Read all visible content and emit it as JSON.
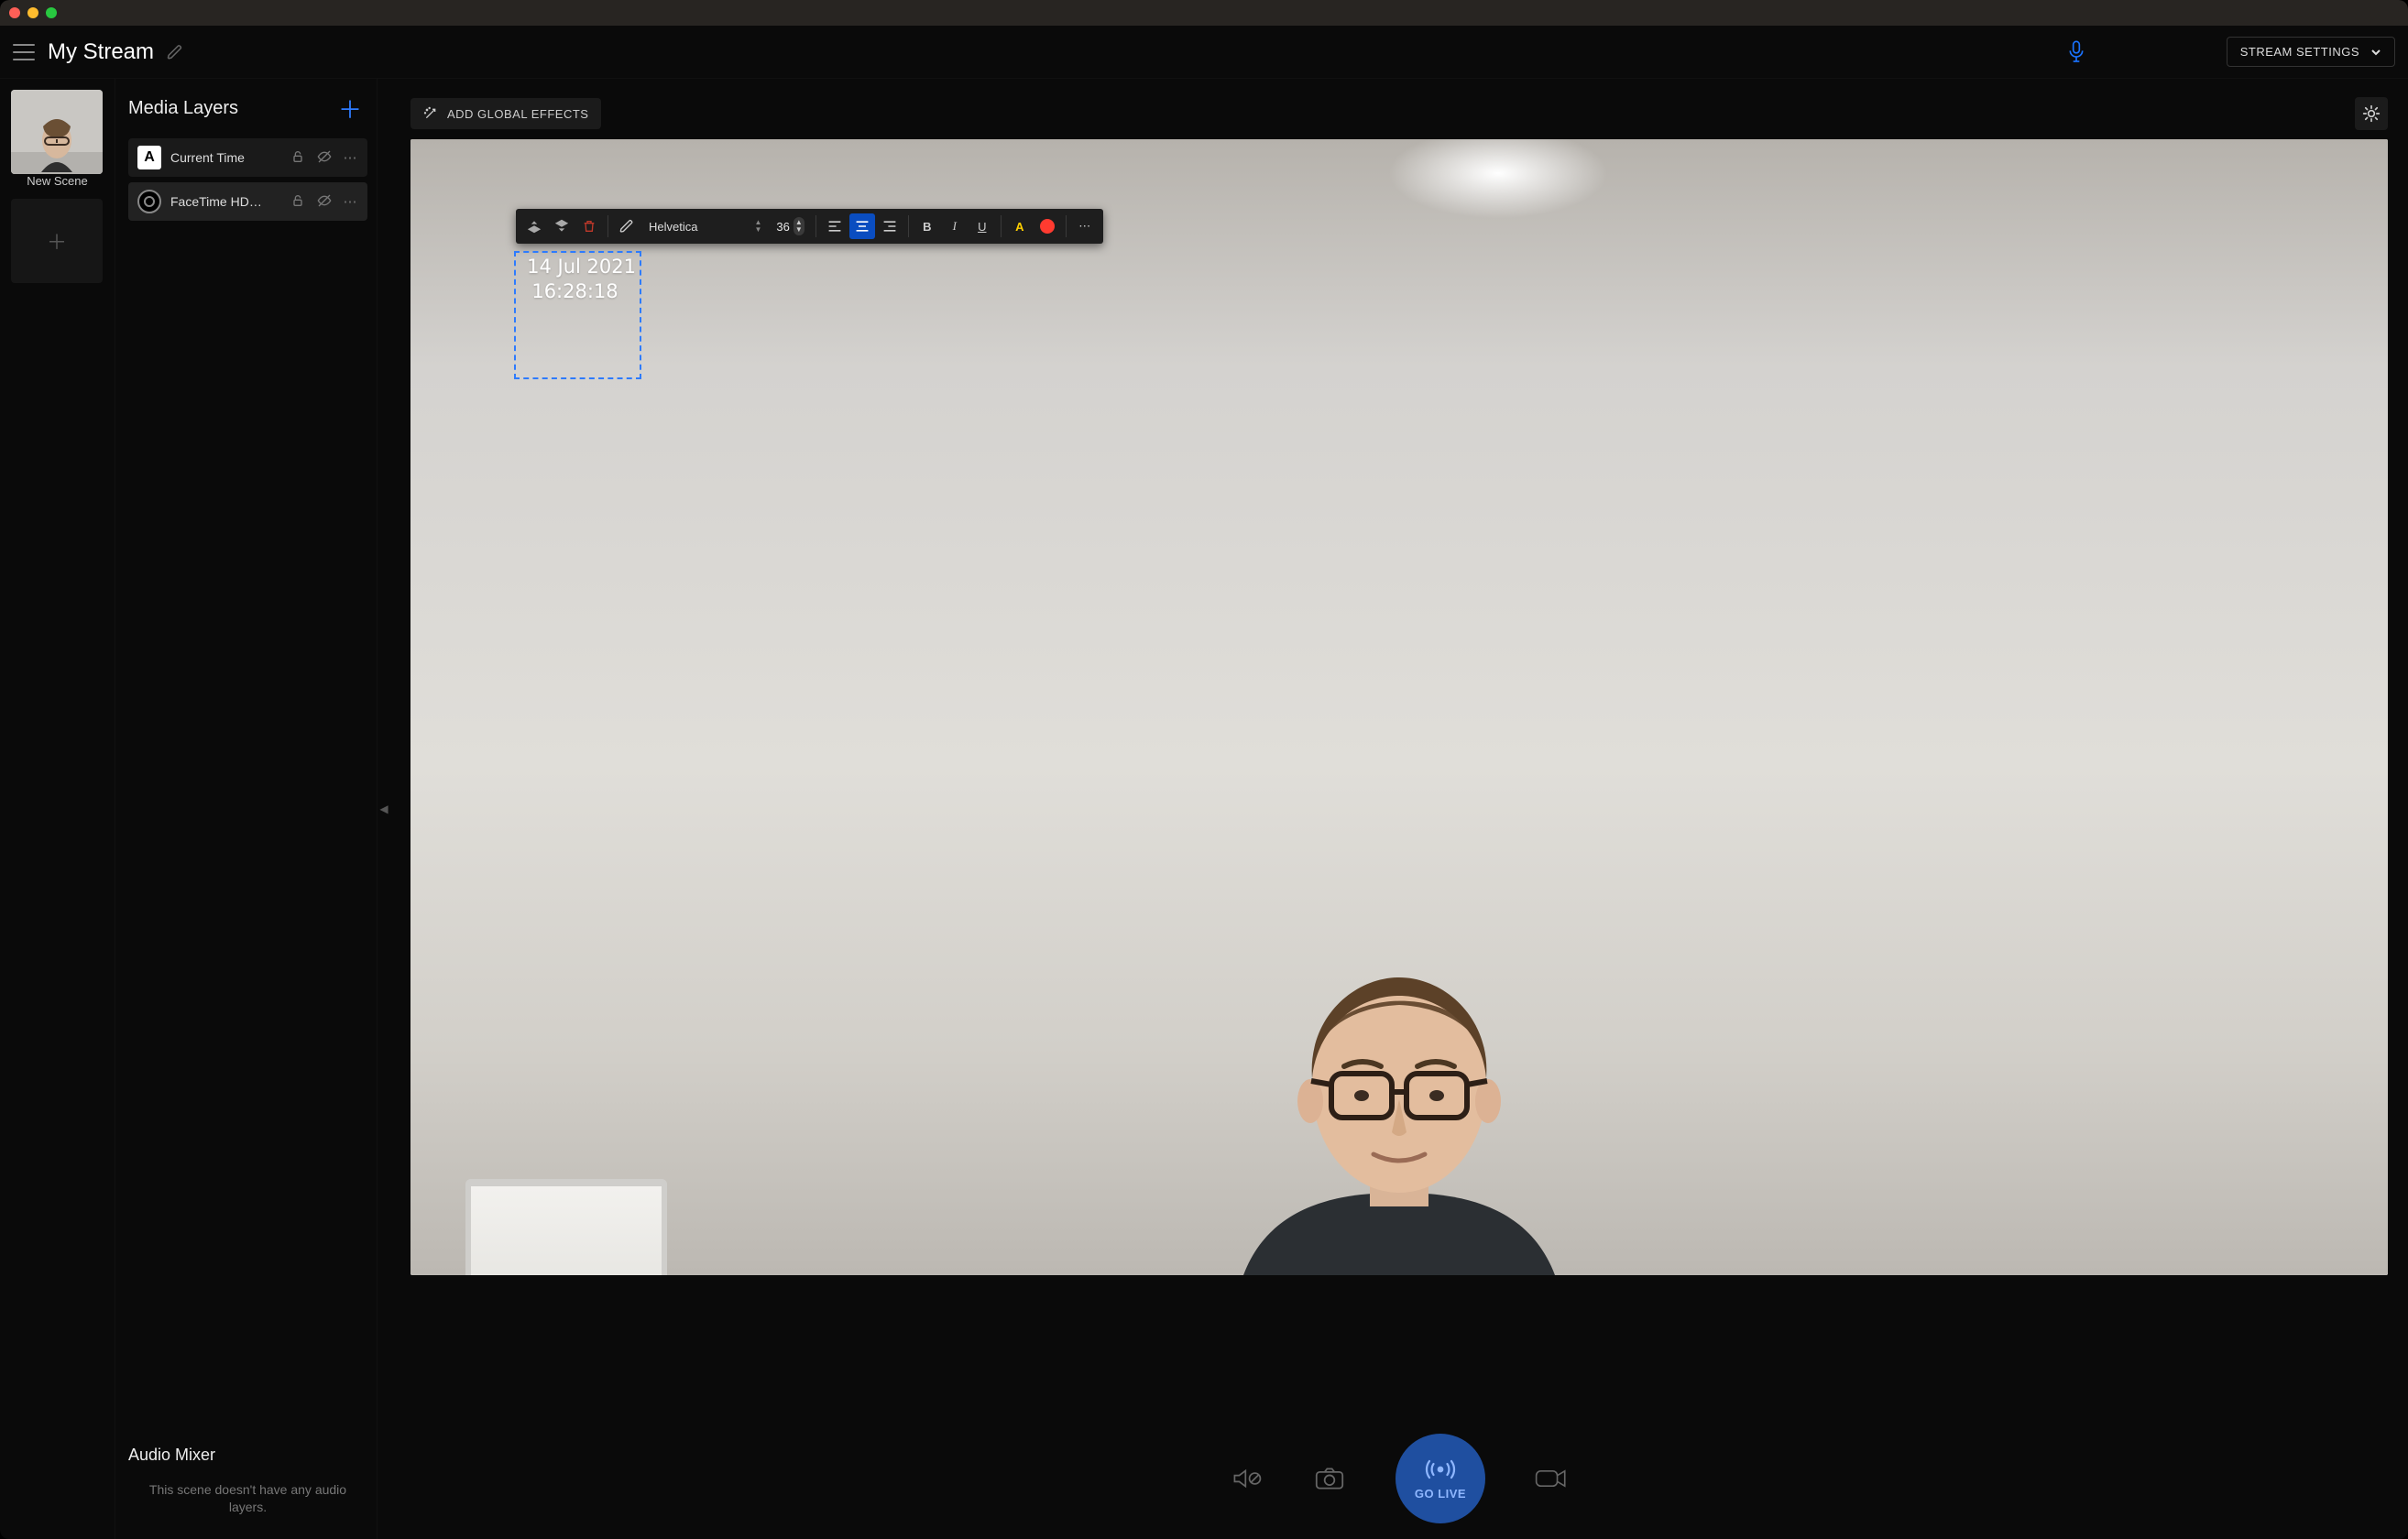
{
  "header": {
    "title": "My Stream",
    "settings_label": "STREAM SETTINGS"
  },
  "scenes": {
    "items": [
      {
        "label": "New Scene"
      }
    ]
  },
  "layers": {
    "title": "Media Layers",
    "items": [
      {
        "name": "Current Time"
      },
      {
        "name": "FaceTime HD…"
      }
    ]
  },
  "mixer": {
    "title": "Audio Mixer",
    "empty": "This scene doesn't have any audio layers."
  },
  "effects": {
    "label": "ADD GLOBAL EFFECTS"
  },
  "text_toolbar": {
    "font": "Helvetica",
    "size": "36",
    "text_color": "#ffcf00",
    "bg_color": "#ff3b30"
  },
  "overlay_text": {
    "line1": "14 Jul 2021",
    "line2": "16:28:18"
  },
  "golive": {
    "label": "GO LIVE"
  }
}
